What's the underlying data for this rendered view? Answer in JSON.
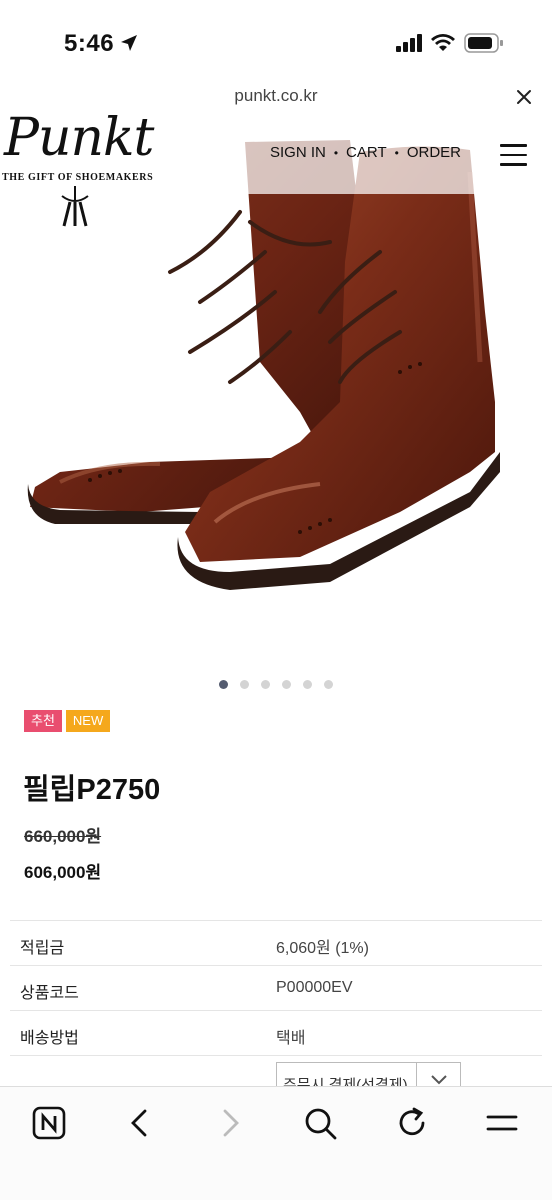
{
  "status_bar": {
    "time": "5:46"
  },
  "browser": {
    "url": "punkt.co.kr"
  },
  "site": {
    "logo_text": "Punkt",
    "logo_tagline": "THE GIFT OF SHOEMAKERS",
    "nav": {
      "sign_in": "SIGN IN",
      "cart": "CART",
      "order": "ORDER"
    },
    "separator": "•"
  },
  "gallery": {
    "slide_count": 6,
    "active_index": 0
  },
  "badges": {
    "recommend": "추천",
    "new": "NEW"
  },
  "product": {
    "name": "필립P2750",
    "original_price": "660,000원",
    "sale_price": "606,000원"
  },
  "info": [
    {
      "label": "적립금",
      "value": "6,060원 (1%)"
    },
    {
      "label": "상품코드",
      "value": "P00000EV"
    },
    {
      "label": "배송방법",
      "value": "택배"
    }
  ],
  "payment_select": {
    "selected": "주문시 결제(선결제)"
  },
  "colors": {
    "badge_recommend": "#e94e6f",
    "badge_new": "#f5a81c",
    "active_dot": "#555c70"
  },
  "toolbar_icons": [
    "naver-icon",
    "back-icon",
    "forward-icon",
    "search-icon",
    "reload-icon",
    "menu-icon"
  ]
}
